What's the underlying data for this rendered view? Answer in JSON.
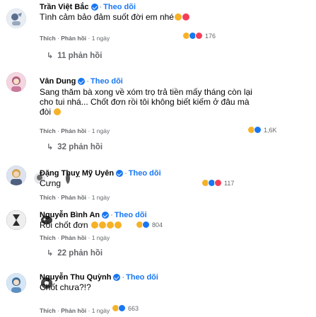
{
  "comments": [
    {
      "name": "Trần Việt Bắc",
      "follow": "Theo dõi",
      "text": "Tình cảm bảo đảm suốt đời em nhé",
      "like": "Thích",
      "reply": "Phản hồi",
      "time": "1 ngày",
      "reaction_count": "176",
      "replies": "11 phản hồi",
      "avatar_color": "#8aa4c8"
    },
    {
      "name": "Vân Dung",
      "follow": "Theo dõi",
      "text_lines": [
        "Sang thăm bà xong về xóm trọ trả tiền mấy tháng còn lại",
        "cho tui nhá... Chốt đơn rồi tôi không biết kiếm ở đâu mà",
        "đòi"
      ],
      "like": "Thích",
      "reply": "Phản hồi",
      "time": "1 ngày",
      "reaction_count": "1,6K",
      "replies": "32 phản hồi",
      "avatar_color": "#c97a9a"
    },
    {
      "name": "Đặng Thuỵ Mỹ Uyên",
      "follow": "Theo dõi",
      "text": "Cưng",
      "like": "Thích",
      "reply": "Phản hồi",
      "time": "1 ngày",
      "reaction_count": "117",
      "avatar_color": "#6b7fa8"
    },
    {
      "name": "Nguyễn Bình An",
      "follow": "Theo dõi",
      "text": "Rồi chốt đơn",
      "like": "Thích",
      "reply": "Phản hồi",
      "time": "1 ngày",
      "reaction_count": "804",
      "replies": "22 phản hồi",
      "avatar_color": "#3a3a3a"
    },
    {
      "name": "Nguyễn Thu Quỳnh",
      "follow": "Theo dõi",
      "text": "Chốt chưa?!?",
      "like": "Thích",
      "reply": "Phản hồi",
      "time": "1 ngày",
      "reaction_count": "663",
      "avatar_color": "#5f8fbf"
    }
  ],
  "colors": {
    "link_blue": "#1877f2",
    "meta_gray": "#65676b",
    "like_blue": "#1877f2",
    "love_red": "#f33e58",
    "haha_yellow": "#f7b125"
  }
}
